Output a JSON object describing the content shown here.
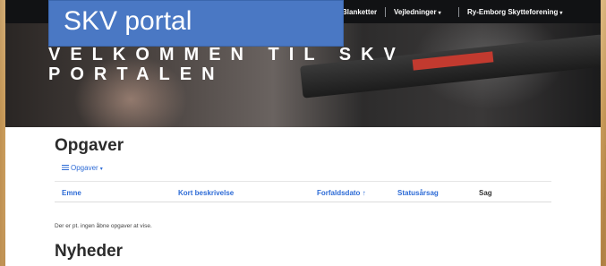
{
  "overlay_label": "SKV portal",
  "navbar": {
    "items": [
      {
        "label": "Blanketter"
      },
      {
        "label": "Vejledninger",
        "caret": "▾"
      },
      {
        "label": "Ry-Emborg Skytteforening",
        "caret": "▾"
      }
    ]
  },
  "hero": {
    "line1": "VELKOMMEN TIL SKV",
    "line2": "PORTALEN"
  },
  "tasks": {
    "heading": "Opgaver",
    "dropdown_label": "Opgaver",
    "dropdown_caret": "▾",
    "columns": [
      "Emne",
      "Kort beskrivelse",
      "Forfaldsdato",
      "Statusårsag",
      "Sag"
    ],
    "sort_indicator": "↑",
    "empty_text": "Der er pt. ingen åbne opgaver at vise."
  },
  "news": {
    "heading": "Nyheder"
  },
  "colors": {
    "navbar": "#111214",
    "link": "#2d6bd6",
    "overlay": "#4a78c4"
  }
}
